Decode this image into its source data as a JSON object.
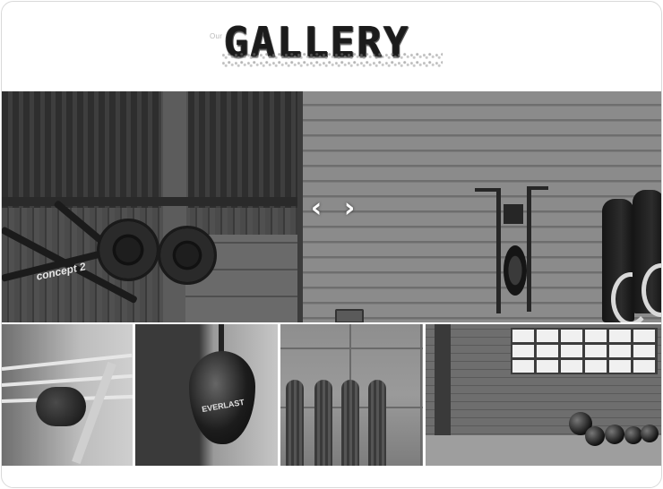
{
  "header": {
    "eyebrow": "Our",
    "title": "GALLERY"
  },
  "slider": {
    "prev_icon": "‹",
    "next_icon": "›",
    "brand_text": "concept 2"
  },
  "thumbnails": {
    "bag_brand": "EVERLAST"
  },
  "colors": {
    "background": "#ffffff",
    "frame_border": "#d9d9d9",
    "title": "#1b1b1b",
    "arrow": "#ffffff"
  }
}
